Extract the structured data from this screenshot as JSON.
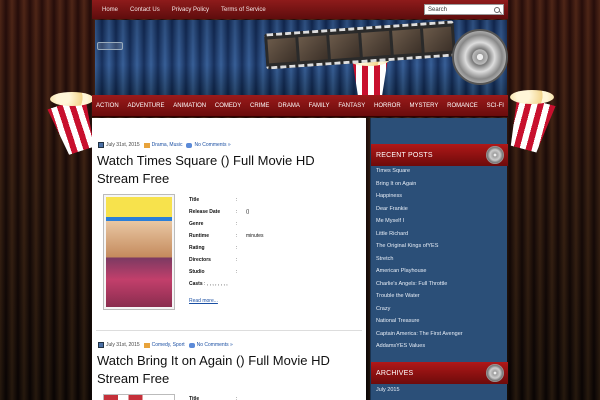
{
  "topnav": {
    "links": [
      "Home",
      "Contact Us",
      "Privacy Policy",
      "Terms of Service"
    ],
    "search_value": "Search"
  },
  "categories": [
    "ACTION",
    "ADVENTURE",
    "ANIMATION",
    "COMEDY",
    "CRIME",
    "DRAMA",
    "FAMILY",
    "FANTASY",
    "HORROR",
    "MYSTERY",
    "ROMANCE",
    "SCI-FI"
  ],
  "posts": [
    {
      "date": "July 31st, 2015",
      "categories": "Drama, Music",
      "comments": "No Comments »",
      "title": "Watch Times Square () Full Movie HD Stream Free",
      "fields": [
        {
          "key": "Title",
          "sep": ":",
          "val": ""
        },
        {
          "key": "Release Date",
          "sep": ":",
          "val": "()"
        },
        {
          "key": "Genre",
          "sep": ":",
          "val": ""
        },
        {
          "key": "Runtime",
          "sep": ":",
          "val": "minutes"
        },
        {
          "key": "Rating",
          "sep": ":",
          "val": ""
        },
        {
          "key": "Directors",
          "sep": ":",
          "val": ""
        },
        {
          "key": "Studio",
          "sep": ":",
          "val": ""
        },
        {
          "key": "Casts",
          "sep": ":",
          "val": ", , , , , , , ,"
        }
      ],
      "read_more": "Read more..."
    },
    {
      "date": "July 31st, 2015",
      "categories": "Comedy, Sport",
      "comments": "No Comments »",
      "title": "Watch Bring It on Again () Full Movie HD Stream Free",
      "fields": [
        {
          "key": "Title",
          "sep": ":",
          "val": ""
        }
      ]
    }
  ],
  "sidebar": {
    "recent_title": "RECENT POSTS",
    "recent_posts": [
      "Times Square",
      "Bring It on Again",
      "Happiness",
      "Dear Frankie",
      "Me Myself I",
      "Little Richard",
      "The Original Kings ofYES",
      "Stretch",
      "American Playhouse",
      "Charlie's Angels: Full Throttle",
      "Trouble the Water",
      "Crazy",
      "National Treasure",
      "Captain America: The First Avenger",
      "AddamsYES Values"
    ],
    "archives_title": "ARCHIVES",
    "archives": [
      "July 2015"
    ]
  }
}
